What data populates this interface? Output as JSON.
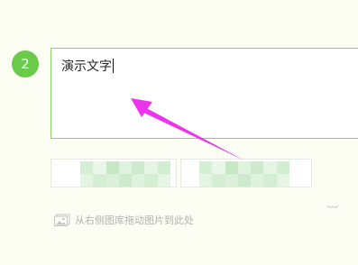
{
  "step": {
    "number": "2"
  },
  "editor": {
    "text": "演示文字"
  },
  "image_slots": {
    "count": 2
  },
  "hint": {
    "text": "从右侧图库拖动图片到此处"
  },
  "icons": {
    "hint_icon": "image-icon",
    "corner_icon": "chevron-down-icon",
    "annotation": "arrow-icon"
  },
  "colors": {
    "accent_green": "#6acb4a",
    "box_border": "#8fd06e",
    "annotation_arrow": "#ee33ee",
    "background": "#fcfdf3"
  }
}
